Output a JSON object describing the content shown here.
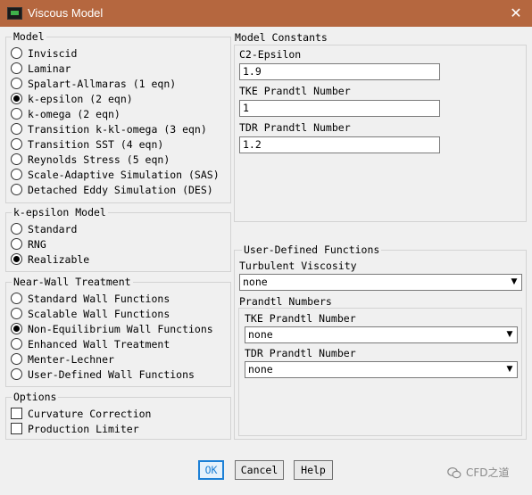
{
  "window": {
    "title": "Viscous Model",
    "close_glyph": "✕"
  },
  "model": {
    "title": "Model",
    "options": [
      {
        "label": "Inviscid",
        "selected": false
      },
      {
        "label": "Laminar",
        "selected": false
      },
      {
        "label": "Spalart-Allmaras (1 eqn)",
        "selected": false
      },
      {
        "label": "k-epsilon (2 eqn)",
        "selected": true
      },
      {
        "label": "k-omega (2 eqn)",
        "selected": false
      },
      {
        "label": "Transition k-kl-omega (3 eqn)",
        "selected": false
      },
      {
        "label": "Transition SST (4 eqn)",
        "selected": false
      },
      {
        "label": "Reynolds Stress (5 eqn)",
        "selected": false
      },
      {
        "label": "Scale-Adaptive Simulation (SAS)",
        "selected": false
      },
      {
        "label": "Detached Eddy Simulation (DES)",
        "selected": false
      }
    ]
  },
  "kepsilon_model": {
    "title": "k-epsilon Model",
    "options": [
      {
        "label": "Standard",
        "selected": false
      },
      {
        "label": "RNG",
        "selected": false
      },
      {
        "label": "Realizable",
        "selected": true
      }
    ]
  },
  "near_wall": {
    "title": "Near-Wall Treatment",
    "options": [
      {
        "label": "Standard Wall Functions",
        "selected": false
      },
      {
        "label": "Scalable Wall Functions",
        "selected": false
      },
      {
        "label": "Non-Equilibrium Wall Functions",
        "selected": true
      },
      {
        "label": "Enhanced Wall Treatment",
        "selected": false
      },
      {
        "label": "Menter-Lechner",
        "selected": false
      },
      {
        "label": "User-Defined Wall Functions",
        "selected": false
      }
    ]
  },
  "options": {
    "title": "Options",
    "checkboxes": [
      {
        "label": "Curvature Correction",
        "checked": false
      },
      {
        "label": "Production Limiter",
        "checked": false
      }
    ]
  },
  "model_constants": {
    "title": "Model Constants",
    "fields": [
      {
        "label": "C2-Epsilon",
        "value": "1.9"
      },
      {
        "label": "TKE Prandtl Number",
        "value": "1"
      },
      {
        "label": "TDR Prandtl Number",
        "value": "1.2"
      }
    ]
  },
  "udf": {
    "title": "User-Defined Functions",
    "turbulent_viscosity_label": "Turbulent Viscosity",
    "turbulent_viscosity_value": "none",
    "prandtl_numbers_title": "Prandtl Numbers",
    "tke_label": "TKE Prandtl Number",
    "tke_value": "none",
    "tdr_label": "TDR Prandtl Number",
    "tdr_value": "none"
  },
  "buttons": {
    "ok": "OK",
    "cancel": "Cancel",
    "help": "Help"
  },
  "watermark": {
    "text": "CFD之道",
    "icon": "wechat-icon"
  },
  "colors": {
    "titlebar": "#b5673f",
    "default_button": "#1c80d6"
  }
}
